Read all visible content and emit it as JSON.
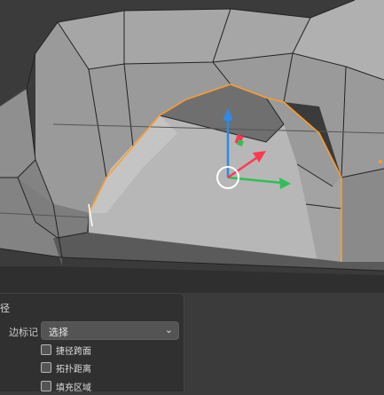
{
  "viewport": {
    "gizmo_colors": {
      "x": "#2fbf55",
      "y": "#ff3852",
      "z": "#2e8ae6"
    }
  },
  "panel": {
    "title": "径",
    "edge_mark_label": "边标记",
    "edge_mark_value": "选择",
    "checkboxes": [
      {
        "label": "捷径跨面",
        "checked": false
      },
      {
        "label": "拓扑距离",
        "checked": false
      },
      {
        "label": "填充区域",
        "checked": false
      }
    ]
  }
}
